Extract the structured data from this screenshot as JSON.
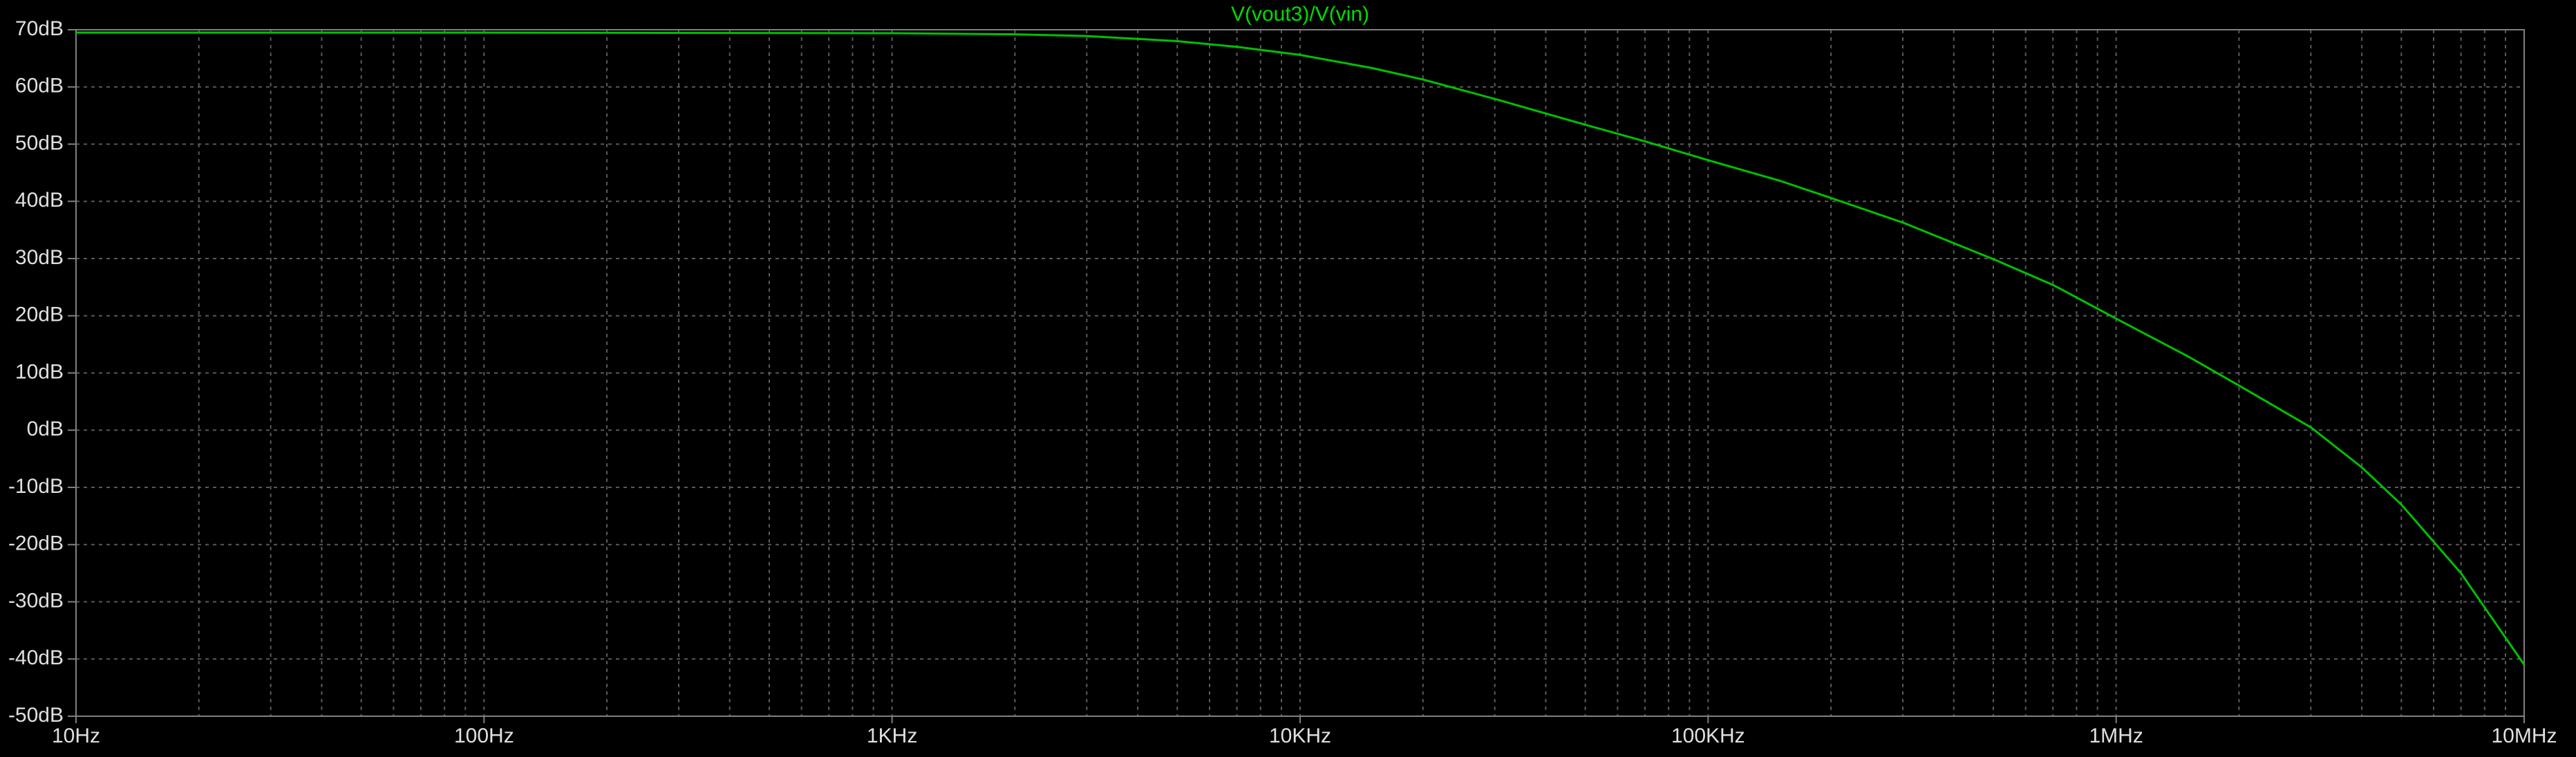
{
  "colors": {
    "background": "#000000",
    "frame": "#808080",
    "grid": "#5a5a5a",
    "tick_text": "#e0e0e0",
    "trace": "#00c000",
    "title": "#00dd00"
  },
  "chart_data": {
    "type": "line",
    "title": "V(vout3)/V(vin)",
    "x_scale": "log",
    "xlim": [
      10,
      10000000
    ],
    "ylim": [
      -50,
      70
    ],
    "grid": true,
    "legend": "none",
    "x_ticks": [
      {
        "value": 10,
        "label": "10Hz"
      },
      {
        "value": 100,
        "label": "100Hz"
      },
      {
        "value": 1000,
        "label": "1KHz"
      },
      {
        "value": 10000,
        "label": "10KHz"
      },
      {
        "value": 100000,
        "label": "100KHz"
      },
      {
        "value": 1000000,
        "label": "1MHz"
      },
      {
        "value": 10000000,
        "label": "10MHz"
      }
    ],
    "y_ticks": [
      {
        "value": 70,
        "label": "70dB"
      },
      {
        "value": 60,
        "label": "60dB"
      },
      {
        "value": 50,
        "label": "50dB"
      },
      {
        "value": 40,
        "label": "40dB"
      },
      {
        "value": 30,
        "label": "30dB"
      },
      {
        "value": 20,
        "label": "20dB"
      },
      {
        "value": 10,
        "label": "10dB"
      },
      {
        "value": 0,
        "label": "0dB"
      },
      {
        "value": -10,
        "label": "-10dB"
      },
      {
        "value": -20,
        "label": "-20dB"
      },
      {
        "value": -30,
        "label": "-30dB"
      },
      {
        "value": -40,
        "label": "-40dB"
      },
      {
        "value": -50,
        "label": "-50dB"
      }
    ],
    "series": [
      {
        "x": [
          10,
          100,
          1000,
          2000,
          3000,
          5000,
          7000,
          10000,
          15000,
          20000,
          30000,
          50000,
          70000,
          100000,
          150000,
          200000,
          300000,
          500000,
          700000,
          1000000,
          1500000,
          2000000,
          3000000,
          4000000,
          5000000,
          7000000,
          10000000
        ],
        "y": [
          69.5,
          69.5,
          69.4,
          69.2,
          68.9,
          68.0,
          67.0,
          65.6,
          63.3,
          61.3,
          57.9,
          53.4,
          50.5,
          47.2,
          43.6,
          40.6,
          36.3,
          29.9,
          25.4,
          19.5,
          12.9,
          7.8,
          0.5,
          -6.5,
          -13.0,
          -25.0,
          -41.0
        ]
      }
    ]
  }
}
